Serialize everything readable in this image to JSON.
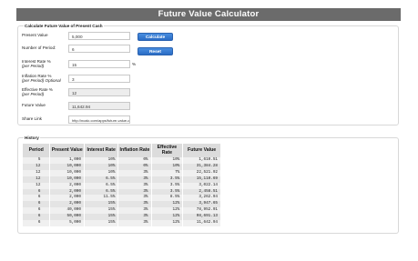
{
  "page_title": "Future Value Calculator",
  "calculator": {
    "legend": "Calculate Future Value of Present Cash",
    "present_value_label": "Present Value",
    "present_value": "5,000",
    "number_of_period_label": "Number of Period:",
    "number_of_period": "6",
    "interest_rate_label": "Interest Rate %",
    "interest_rate_sub": "(per Period)",
    "interest_rate": "15",
    "percent_sign": "%",
    "inflation_rate_label": "Inflation Rate %",
    "inflation_rate_sub": "(per Period) Optional",
    "inflation_rate": "3",
    "effective_rate_label": "Effective Rate %",
    "effective_rate_sub": "(per Period)",
    "effective_rate": "12",
    "future_value_label": "Future Value",
    "future_value": "11,642.94",
    "share_link_label": "Share Link",
    "share_link": "http://ncalc.com/apps/future-value-ca",
    "calculate_button": "Calculate",
    "reset_button": "Reset"
  },
  "history": {
    "legend": "History",
    "columns": [
      "Period",
      "Present Value",
      "Interest Rate",
      "Inflation Rate",
      "Effective Rate",
      "Future Value"
    ],
    "rows": [
      [
        "5",
        "1,000",
        "10%",
        "0%",
        "10%",
        "1,610.51"
      ],
      [
        "12",
        "10,000",
        "10%",
        "0%",
        "10%",
        "31,384.28"
      ],
      [
        "12",
        "10,000",
        "10%",
        "3%",
        "7%",
        "22,521.92"
      ],
      [
        "12",
        "10,000",
        "6.5%",
        "3%",
        "3.5%",
        "15,110.69"
      ],
      [
        "12",
        "2,000",
        "6.5%",
        "3%",
        "3.5%",
        "3,022.14"
      ],
      [
        "6",
        "2,000",
        "6.5%",
        "3%",
        "3.5%",
        "2,458.51"
      ],
      [
        "6",
        "2,000",
        "11.5%",
        "3%",
        "8.5%",
        "3,262.94"
      ],
      [
        "6",
        "2,000",
        "15%",
        "3%",
        "12%",
        "3,947.65"
      ],
      [
        "6",
        "40,000",
        "15%",
        "3%",
        "12%",
        "78,952.91"
      ],
      [
        "6",
        "50,000",
        "15%",
        "3%",
        "12%",
        "98,691.13"
      ],
      [
        "6",
        "5,000",
        "15%",
        "3%",
        "12%",
        "11,642.94"
      ]
    ]
  }
}
